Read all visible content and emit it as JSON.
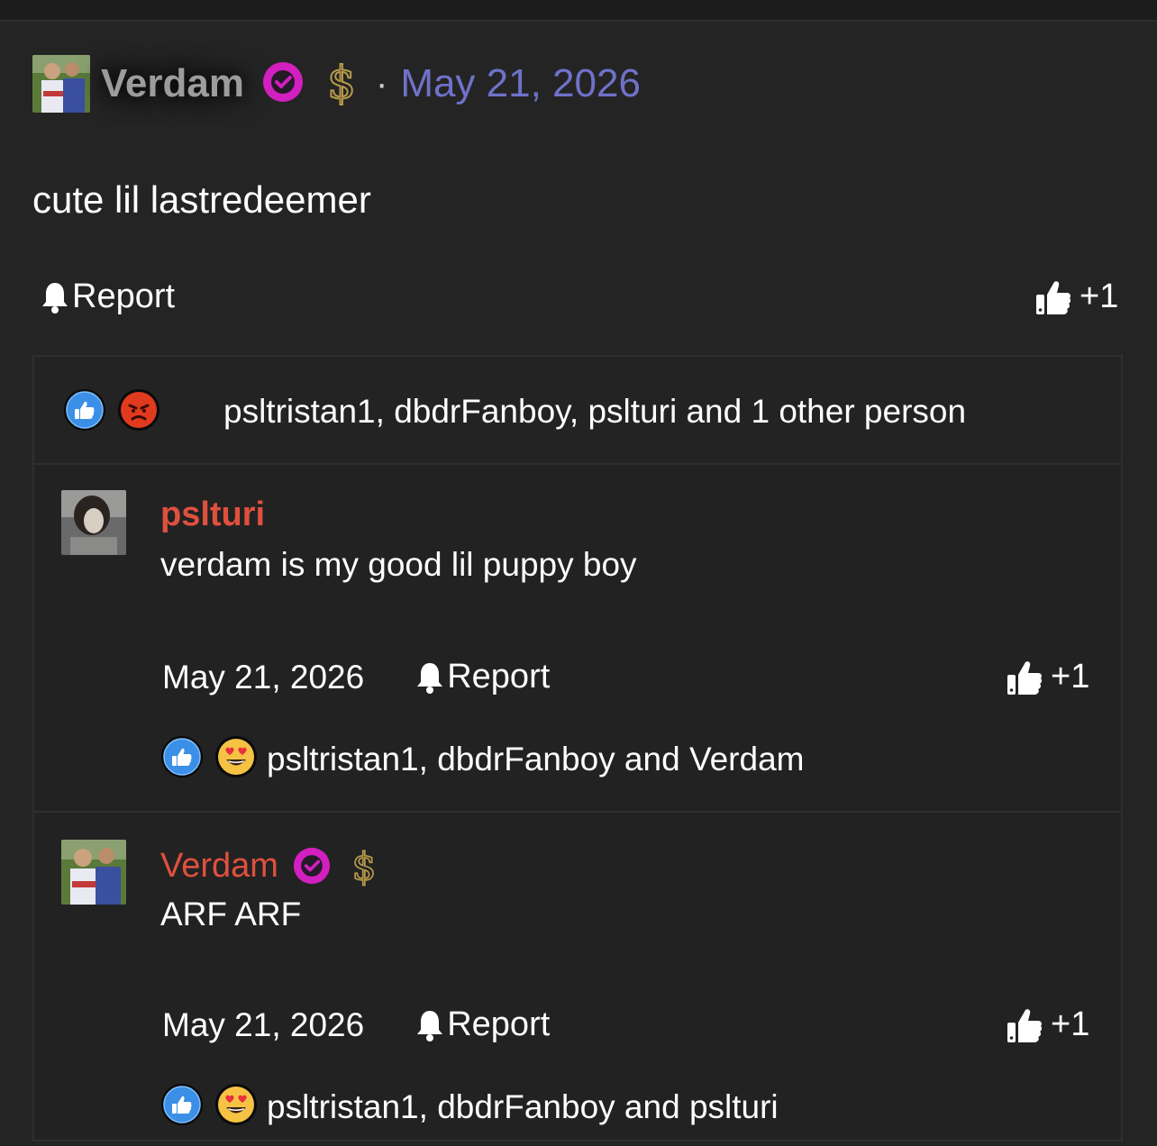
{
  "post": {
    "author": "Verdam",
    "date": "May 21, 2026",
    "separator": "·",
    "body": "cute lil lastredeemer",
    "report_label": "Report",
    "like_count": "+1",
    "reaction_users": "psltristan1, dbdrFanboy, pslturi and 1 other person",
    "reaction_icons": [
      "like-icon",
      "angry-icon"
    ]
  },
  "comments": [
    {
      "author": "pslturi",
      "text": "verdam is my good lil puppy boy",
      "date": "May 21, 2026",
      "report_label": "Report",
      "like_count": "+1",
      "reaction_users": "psltristan1, dbdrFanboy and Verdam",
      "reaction_icons": [
        "like-icon",
        "heart-eyes-icon"
      ]
    },
    {
      "author": "Verdam",
      "text": "ARF ARF",
      "date": "May 21, 2026",
      "report_label": "Report",
      "like_count": "+1",
      "reaction_users": "psltristan1, dbdrFanboy and pslturi",
      "reaction_icons": [
        "like-icon",
        "heart-eyes-icon"
      ]
    }
  ],
  "colors": {
    "background": "#242424",
    "author_highlight": "#e0503e",
    "date_link": "#6f72c9",
    "verified": "#d21fbf",
    "dollar": "#b89a4a"
  }
}
